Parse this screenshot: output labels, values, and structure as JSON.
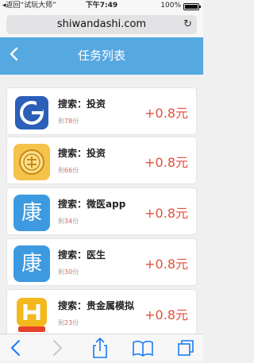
{
  "status_bar": {
    "back_label": "◂返回“试玩大师”",
    "time": "下午7:49",
    "battery": "100%"
  },
  "browser": {
    "url": "shiwandashi.com"
  },
  "header": {
    "title": "任务列表"
  },
  "tasks": [
    {
      "title": "搜索：投资",
      "remaining_prefix": "剩",
      "remaining_count": "78",
      "remaining_suffix": "份",
      "reward": "+0.8元",
      "icon": "circle-g-logo-icon"
    },
    {
      "title": "搜索：投资",
      "remaining_prefix": "剩",
      "remaining_count": "66",
      "remaining_suffix": "份",
      "reward": "+0.8元",
      "icon": "coin-logo-icon"
    },
    {
      "title": "搜索：微医app",
      "remaining_prefix": "剩",
      "remaining_count": "34",
      "remaining_suffix": "份",
      "reward": "+0.8元",
      "icon": "kang-logo-icon",
      "icon_text": "康"
    },
    {
      "title": "搜索：医生",
      "remaining_prefix": "剩",
      "remaining_count": "30",
      "remaining_suffix": "份",
      "reward": "+0.8元",
      "icon": "kang-logo-icon",
      "icon_text": "康"
    },
    {
      "title": "搜索：贵金属模拟",
      "remaining_prefix": "剩",
      "remaining_count": "23",
      "remaining_suffix": "份",
      "reward": "+0.8元",
      "icon": "h-logo-icon"
    }
  ],
  "colors": {
    "header": "#56a8e1",
    "reward": "#e0503a",
    "ios_blue": "#1a7cf5"
  }
}
